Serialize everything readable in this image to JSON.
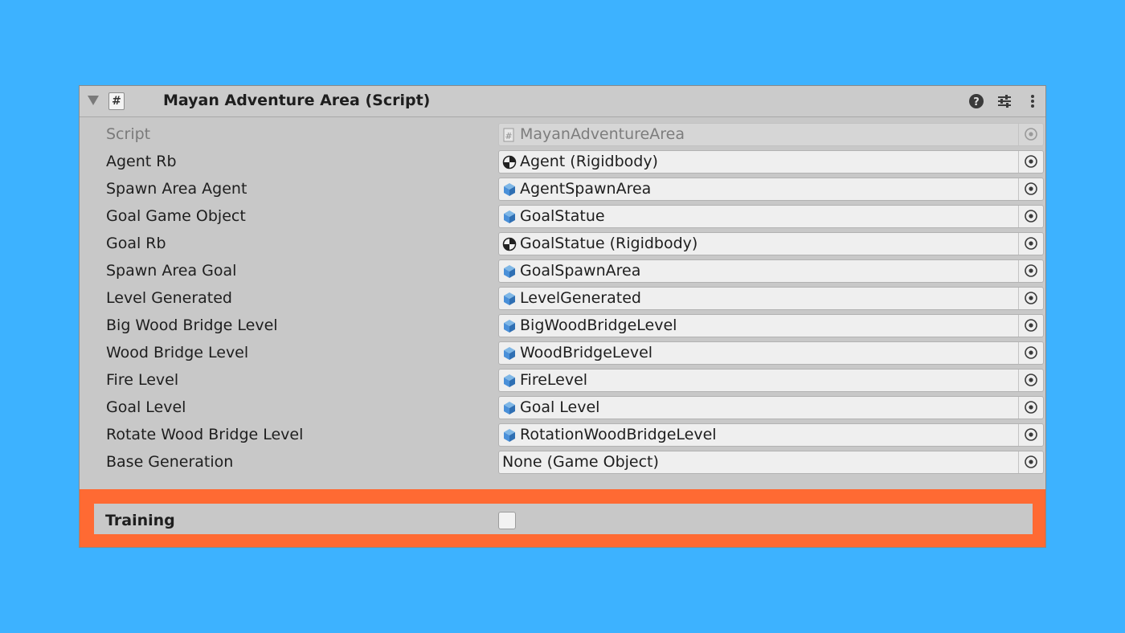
{
  "header": {
    "title": "Mayan Adventure Area (Script)",
    "script_icon_glyph": "#",
    "icons": [
      "help-icon",
      "presets-icon",
      "more-options-icon"
    ]
  },
  "fields": [
    {
      "label": "Script",
      "value": "MayanAdventureArea",
      "icon": "script-icon",
      "disabled": true
    },
    {
      "label": "Agent Rb",
      "value": "Agent (Rigidbody)",
      "icon": "rigidbody-icon"
    },
    {
      "label": "Spawn Area Agent",
      "value": "AgentSpawnArea",
      "icon": "gameobject-cube-icon"
    },
    {
      "label": "Goal Game Object",
      "value": "GoalStatue",
      "icon": "gameobject-cube-icon"
    },
    {
      "label": "Goal Rb",
      "value": "GoalStatue (Rigidbody)",
      "icon": "rigidbody-icon"
    },
    {
      "label": "Spawn Area Goal",
      "value": "GoalSpawnArea",
      "icon": "gameobject-cube-icon"
    },
    {
      "label": "Level Generated",
      "value": "LevelGenerated",
      "icon": "gameobject-cube-icon"
    },
    {
      "label": "Big Wood Bridge Level",
      "value": "BigWoodBridgeLevel",
      "icon": "gameobject-cube-icon"
    },
    {
      "label": "Wood Bridge Level",
      "value": "WoodBridgeLevel",
      "icon": "gameobject-cube-icon"
    },
    {
      "label": "Fire Level",
      "value": "FireLevel",
      "icon": "gameobject-cube-icon"
    },
    {
      "label": "Goal Level",
      "value": "Goal Level",
      "icon": "gameobject-cube-icon"
    },
    {
      "label": "Rotate Wood Bridge Level",
      "value": "RotationWoodBridgeLevel",
      "icon": "gameobject-cube-icon"
    },
    {
      "label": "Base Generation",
      "value": "None (Game Object)",
      "icon": ""
    }
  ],
  "training": {
    "label": "Training",
    "checked": false
  },
  "colors": {
    "background": "#3db2ff",
    "highlight": "#ff6a33",
    "panel": "#c8c8c8",
    "cube_icon": "#4a90d9"
  }
}
